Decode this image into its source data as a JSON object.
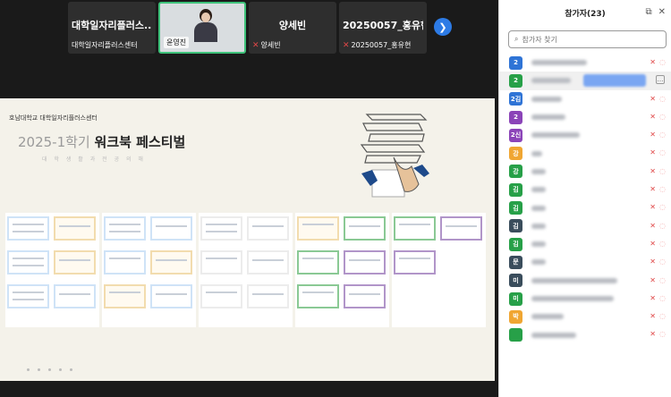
{
  "videos": [
    {
      "name": "대학일자리플러스...",
      "caption": "대학일자리플러스센터",
      "muted": false
    },
    {
      "name": "",
      "caption": "윤영진",
      "muted": false,
      "active": true
    },
    {
      "name": "양세빈",
      "caption": "양세빈",
      "muted": true
    },
    {
      "name": "20250057_홍유현",
      "caption": "20250057_홍유현",
      "muted": true
    }
  ],
  "next_icon": "chevron-right-icon",
  "slide": {
    "org": "호남대학교 대학일자리플러스센터",
    "title_light": "2025-1학기",
    "title_bold": "워크북 페스티벌",
    "subtitle": "대 학 생 활 과   전 공 의 해"
  },
  "panel": {
    "title": "참가자(23)",
    "search_placeholder": "참가자 찾기",
    "participants": [
      {
        "initial": "2",
        "color": "#2f74d6",
        "w": 62
      },
      {
        "initial": "2",
        "color": "#27a048",
        "w": 44,
        "selected": true
      },
      {
        "initial": "2김",
        "color": "#2f74d6",
        "w": 34
      },
      {
        "initial": "2",
        "color": "#8b44b8",
        "w": 38
      },
      {
        "initial": "2신",
        "color": "#8b44b8",
        "w": 54
      },
      {
        "initial": "강",
        "color": "#f0a632",
        "w": 12
      },
      {
        "initial": "강",
        "color": "#27a048",
        "w": 16
      },
      {
        "initial": "김",
        "color": "#27a048",
        "w": 16
      },
      {
        "initial": "김",
        "color": "#27a048",
        "w": 16
      },
      {
        "initial": "김",
        "color": "#3a4d5c",
        "w": 16
      },
      {
        "initial": "김",
        "color": "#27a048",
        "w": 16
      },
      {
        "initial": "문",
        "color": "#3a4d5c",
        "w": 16
      },
      {
        "initial": "미",
        "color": "#3a4d5c",
        "w": 96
      },
      {
        "initial": "미",
        "color": "#27a048",
        "w": 92
      },
      {
        "initial": "박",
        "color": "#f0a632",
        "w": 36
      },
      {
        "initial": "",
        "color": "#27a048",
        "w": 50
      }
    ]
  }
}
